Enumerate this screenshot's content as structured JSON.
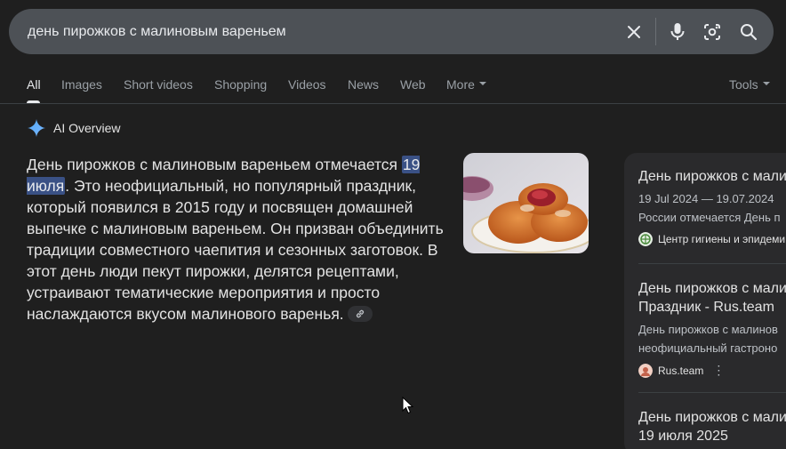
{
  "search": {
    "query": "день пирожков с малиновым вареньем"
  },
  "tabs": [
    {
      "label": "All",
      "active": true
    },
    {
      "label": "Images"
    },
    {
      "label": "Short videos"
    },
    {
      "label": "Shopping"
    },
    {
      "label": "Videos"
    },
    {
      "label": "News"
    },
    {
      "label": "Web"
    },
    {
      "label": "More"
    }
  ],
  "tools_label": "Tools",
  "ai_overview": {
    "title": "AI Overview",
    "text_before": "День пирожков с малиновым вареньем отмечается ",
    "highlight": "19 июля",
    "text_after": ". Это неофициальный, но популярный праздник, который появился в 2015 году и посвящен домашней выпечке с малиновым вареньем. Он призван объединить традиции совместного чаепития и сезонных заготовок. В этот день люди пекут пирожки, делятся рецептами, устраивают тематические мероприятия и просто наслаждаются вкусом малинового варенья.",
    "image_alt": "pies-with-raspberry-jam-photo"
  },
  "sources": [
    {
      "title": "День пирожков с малин",
      "meta1": "19 Jul 2024 — 19.07.2024",
      "meta2": "России отмечается День п",
      "site": "Центр гигиены и эпидеми"
    },
    {
      "title": "День пирожков с мали",
      "title2": "Праздник - Rus.team",
      "meta1": "День пирожков с малинов",
      "meta2": "неофициальный гастроно",
      "site": "Rus.team"
    },
    {
      "title": "День пирожков с мали",
      "title2": "19 июля 2025"
    }
  ],
  "colors": {
    "background": "#1f1f1f",
    "search_bar": "#4d5156",
    "highlight": "#3a5185",
    "card": "#2a2a2c"
  }
}
